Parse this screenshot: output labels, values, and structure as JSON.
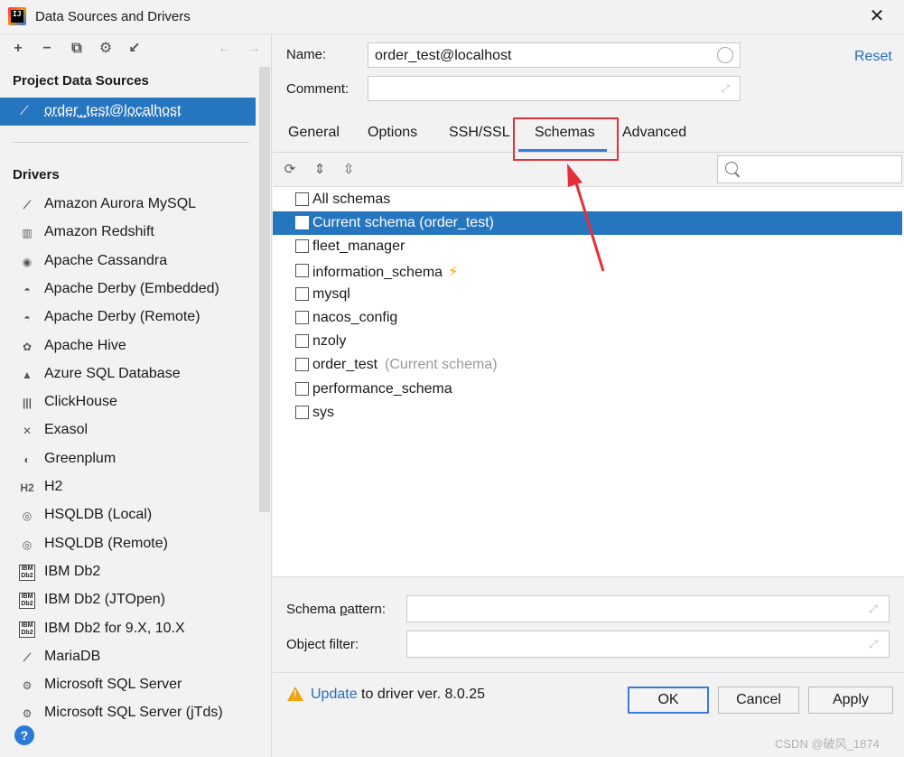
{
  "window": {
    "title": "Data Sources and Drivers",
    "app_icon": "IJ",
    "close_icon": "close-icon"
  },
  "left_panel": {
    "toolbar": {
      "add": "+",
      "remove": "−",
      "duplicate": "⧉",
      "properties": "⚙",
      "import": "↙",
      "back": "←",
      "forward": "→"
    },
    "project_section_title": "Project Data Sources",
    "selected_data_source": "order_test@localhost",
    "drivers_section_title": "Drivers",
    "drivers": [
      {
        "label": "Amazon Aurora MySQL",
        "icon": "dolphin-icon",
        "glyph": "⟋"
      },
      {
        "label": "Amazon Redshift",
        "icon": "redshift-icon",
        "glyph": "▥"
      },
      {
        "label": "Apache Cassandra",
        "icon": "eye-icon",
        "glyph": "◉"
      },
      {
        "label": "Apache Derby (Embedded)",
        "icon": "hat-icon",
        "glyph": "◓"
      },
      {
        "label": "Apache Derby (Remote)",
        "icon": "hat-icon",
        "glyph": "◓"
      },
      {
        "label": "Apache Hive",
        "icon": "hive-icon",
        "glyph": "✿"
      },
      {
        "label": "Azure SQL Database",
        "icon": "azure-icon",
        "glyph": "▲"
      },
      {
        "label": "ClickHouse",
        "icon": "clickhouse-icon",
        "glyph": "|||"
      },
      {
        "label": "Exasol",
        "icon": "exasol-icon",
        "glyph": "✕"
      },
      {
        "label": "Greenplum",
        "icon": "greenplum-icon",
        "glyph": "◐"
      },
      {
        "label": "H2",
        "icon": "h2-icon",
        "glyph": "H2"
      },
      {
        "label": "HSQLDB (Local)",
        "icon": "hsqldb-icon",
        "glyph": "◎"
      },
      {
        "label": "HSQLDB (Remote)",
        "icon": "hsqldb-icon",
        "glyph": "◎"
      },
      {
        "label": "IBM Db2",
        "icon": "ibm-db2-icon",
        "glyph": "IBM Db2"
      },
      {
        "label": "IBM Db2 (JTOpen)",
        "icon": "ibm-db2-icon",
        "glyph": "IBM Db2"
      },
      {
        "label": "IBM Db2 for 9.X, 10.X",
        "icon": "ibm-db2-icon",
        "glyph": "IBM Db2"
      },
      {
        "label": "MariaDB",
        "icon": "mariadb-icon",
        "glyph": "⟋"
      },
      {
        "label": "Microsoft SQL Server",
        "icon": "sqlserver-icon",
        "glyph": "⚙"
      },
      {
        "label": "Microsoft SQL Server (jTds)",
        "icon": "sqlserver-icon",
        "glyph": "⚙"
      }
    ],
    "help": "?"
  },
  "form": {
    "name_label": "Name:",
    "name_value": "order_test@localhost",
    "comment_label": "Comment:",
    "comment_value": "",
    "reset_label": "Reset"
  },
  "tabs": [
    "General",
    "Options",
    "SSH/SSL",
    "Schemas",
    "Advanced"
  ],
  "active_tab": "Schemas",
  "schema_toolbar": {
    "refresh": "⟳",
    "expand_all": "⇕",
    "collapse_all": "⇳",
    "search_placeholder": ""
  },
  "schemas": [
    {
      "name": "All schemas",
      "note": "",
      "checked": false,
      "selected": false,
      "bolt": false
    },
    {
      "name": "Current schema (order_test)",
      "note": "",
      "checked": false,
      "selected": true,
      "bolt": false
    },
    {
      "name": "fleet_manager",
      "note": "",
      "checked": false,
      "selected": false,
      "bolt": false
    },
    {
      "name": "information_schema",
      "note": "",
      "checked": false,
      "selected": false,
      "bolt": true
    },
    {
      "name": "mysql",
      "note": "",
      "checked": false,
      "selected": false,
      "bolt": false
    },
    {
      "name": "nacos_config",
      "note": "",
      "checked": false,
      "selected": false,
      "bolt": false
    },
    {
      "name": "nzoly",
      "note": "",
      "checked": false,
      "selected": false,
      "bolt": false
    },
    {
      "name": "order_test",
      "note": "(Current schema)",
      "checked": false,
      "selected": false,
      "bolt": false
    },
    {
      "name": "performance_schema",
      "note": "",
      "checked": false,
      "selected": false,
      "bolt": false
    },
    {
      "name": "sys",
      "note": "",
      "checked": false,
      "selected": false,
      "bolt": false
    }
  ],
  "schema_pattern": {
    "label_pre": "Schema ",
    "label_u": "p",
    "label_post": "attern:",
    "value": ""
  },
  "object_filter": {
    "label": "Object filter:",
    "value": ""
  },
  "warning": {
    "link": "Update",
    "text": " to driver ver. 8.0.25"
  },
  "buttons": {
    "ok": "OK",
    "cancel": "Cancel",
    "apply": "Apply"
  },
  "watermark": "CSDN @破风_1874",
  "colors": {
    "accent": "#2675bf",
    "annotation": "#e5303b",
    "link": "#2a6bbf",
    "warning": "#f0a30a"
  }
}
